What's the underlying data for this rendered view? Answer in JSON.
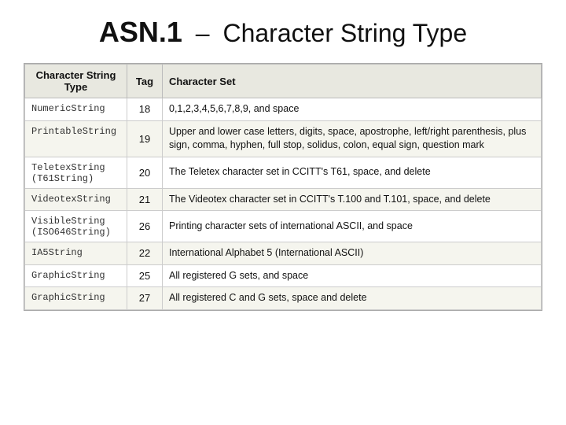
{
  "header": {
    "title_bold": "ASN.1",
    "title_dash": "–",
    "title_rest": "Character String Type"
  },
  "table": {
    "columns": [
      {
        "key": "type",
        "label": "Character String Type"
      },
      {
        "key": "tag",
        "label": "Tag"
      },
      {
        "key": "charset",
        "label": "Character Set"
      }
    ],
    "rows": [
      {
        "type": "NumericString",
        "tag": "18",
        "charset": "0,1,2,3,4,5,6,7,8,9, and space"
      },
      {
        "type": "PrintableString",
        "tag": "19",
        "charset": "Upper and lower case letters, digits, space, apostrophe, left/right parenthesis, plus sign, comma, hyphen, full stop, solidus, colon, equal sign, question mark"
      },
      {
        "type": "TeletexString (T61String)",
        "tag": "20",
        "charset": "The Teletex character set in CCITT's T61, space, and delete"
      },
      {
        "type": "VideotexString",
        "tag": "21",
        "charset": "The Videotex character set in CCITT's T.100 and T.101, space, and delete"
      },
      {
        "type": "VisibleString (ISO646String)",
        "tag": "26",
        "charset": "Printing character sets of international ASCII, and space"
      },
      {
        "type": "IA5String",
        "tag": "22",
        "charset": "International Alphabet 5 (International ASCII)"
      },
      {
        "type": "GraphicString",
        "tag": "25",
        "charset": "All registered G sets, and space"
      },
      {
        "type": "GraphicString",
        "tag": "27",
        "charset": "All registered C and G sets, space and delete"
      }
    ]
  }
}
